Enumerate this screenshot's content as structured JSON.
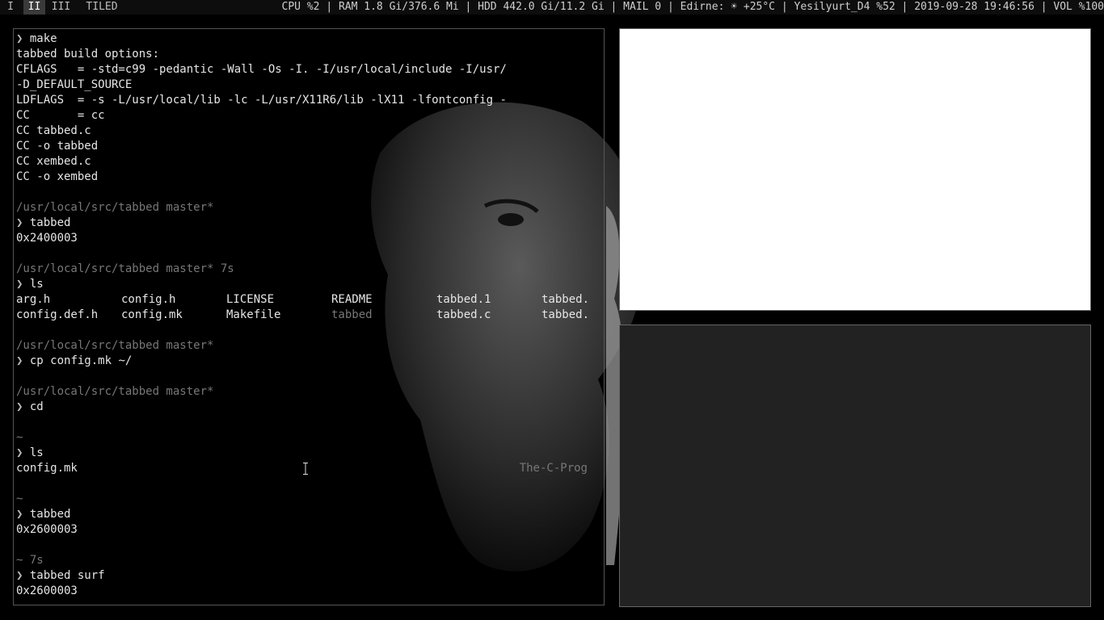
{
  "bar": {
    "tags": [
      "I",
      "II",
      "III",
      "TILED"
    ],
    "active_tag": "II",
    "status": "CPU %2 | RAM 1.8 Gi/376.6 Mi | HDD 442.0 Gi/11.2 Gi | MAIL 0 | Edirne: ☀ +25°C | Yesilyurt_D4 %52 | 2019-09-28 19:46:56 | VOL %100"
  },
  "terminal": {
    "prompt_symbol": "❯",
    "lines": [
      {
        "kind": "cmd",
        "text": "make"
      },
      {
        "kind": "out",
        "text": "tabbed build options:"
      },
      {
        "kind": "out",
        "text": "CFLAGS   = -std=c99 -pedantic -Wall -Os -I. -I/usr/local/include -I/usr/"
      },
      {
        "kind": "out",
        "text": "-D_DEFAULT_SOURCE"
      },
      {
        "kind": "out",
        "text": "LDFLAGS  = -s -L/usr/local/lib -lc -L/usr/X11R6/lib -lX11 -lfontconfig -"
      },
      {
        "kind": "out",
        "text": "CC       = cc"
      },
      {
        "kind": "out",
        "text": "CC tabbed.c"
      },
      {
        "kind": "out",
        "text": "CC -o tabbed"
      },
      {
        "kind": "out",
        "text": "CC xembed.c"
      },
      {
        "kind": "out",
        "text": "CC -o xembed"
      },
      {
        "kind": "blank",
        "text": ""
      },
      {
        "kind": "path",
        "text": "/usr/local/src/tabbed master*"
      },
      {
        "kind": "cmd",
        "text": "tabbed"
      },
      {
        "kind": "out",
        "text": "0x2400003"
      },
      {
        "kind": "blank",
        "text": ""
      },
      {
        "kind": "path",
        "text": "/usr/local/src/tabbed master* 7s"
      },
      {
        "kind": "cmd",
        "text": "ls"
      },
      {
        "kind": "cols",
        "cells": [
          "arg.h",
          "config.h",
          "LICENSE",
          "README",
          "tabbed.1",
          "tabbed."
        ],
        "dim": []
      },
      {
        "kind": "cols",
        "cells": [
          "config.def.h",
          "config.mk",
          "Makefile",
          "tabbed",
          "tabbed.c",
          "tabbed."
        ],
        "dim": [
          3
        ]
      },
      {
        "kind": "blank",
        "text": ""
      },
      {
        "kind": "path",
        "text": "/usr/local/src/tabbed master*"
      },
      {
        "kind": "cmd",
        "text": "cp config.mk ~/"
      },
      {
        "kind": "blank",
        "text": ""
      },
      {
        "kind": "path",
        "text": "/usr/local/src/tabbed master*"
      },
      {
        "kind": "cmd",
        "text": "cd"
      },
      {
        "kind": "blank",
        "text": ""
      },
      {
        "kind": "path",
        "text": "~"
      },
      {
        "kind": "cmd",
        "text": "ls"
      },
      {
        "kind": "out",
        "text": "config.mk",
        "right": "The-C-Prog"
      },
      {
        "kind": "blank",
        "text": ""
      },
      {
        "kind": "path",
        "text": "~"
      },
      {
        "kind": "cmd",
        "text": "tabbed"
      },
      {
        "kind": "out",
        "text": "0x2600003"
      },
      {
        "kind": "blank",
        "text": ""
      },
      {
        "kind": "path",
        "text": "~ 7s"
      },
      {
        "kind": "cmd",
        "text": "tabbed surf"
      },
      {
        "kind": "out",
        "text": "0x2600003"
      }
    ]
  },
  "icons": {
    "cursor": "text-cursor-ibeam-icon"
  },
  "colors": {
    "bar_bg": "#0d0d0d",
    "active_tag_bg": "#3a3a3a",
    "pane_top": "#ffffff",
    "pane_bottom": "#222222"
  }
}
